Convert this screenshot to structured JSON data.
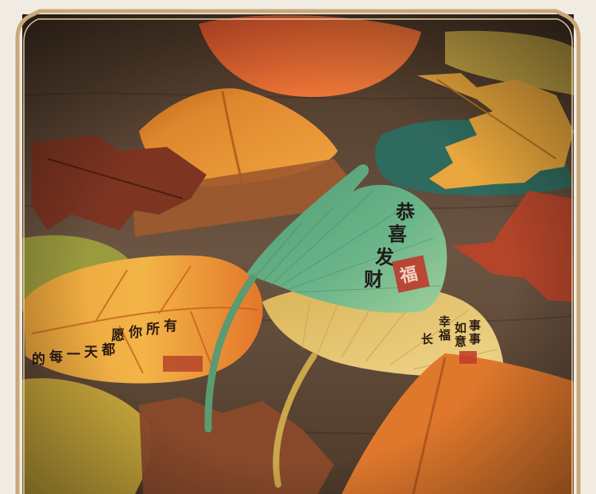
{
  "photo": {
    "subject": "leaf-shaped sticky notes",
    "colors": {
      "background": "#f1ece2",
      "frame_gold": "#c9a77a",
      "wood_dark": "#3a2a1c",
      "wood_mid": "#6b5442",
      "ginkgo_green": "#5fa67a",
      "ginkgo_yellow": "#e9c66a",
      "maple_red": "#b4452a",
      "maple_orange": "#e58a2c",
      "teal_leaf": "#2f6a5e",
      "seal_red": "#c0392b",
      "ink": "#1e1b19"
    }
  },
  "leaves": {
    "green_ginkgo": {
      "lines": [
        "恭",
        "喜",
        "发",
        "财"
      ],
      "seal": "福"
    },
    "yellow_ginkgo": {
      "lines": [
        "事",
        "事",
        "如",
        "意",
        "幸",
        "福",
        "长"
      ]
    }
  }
}
